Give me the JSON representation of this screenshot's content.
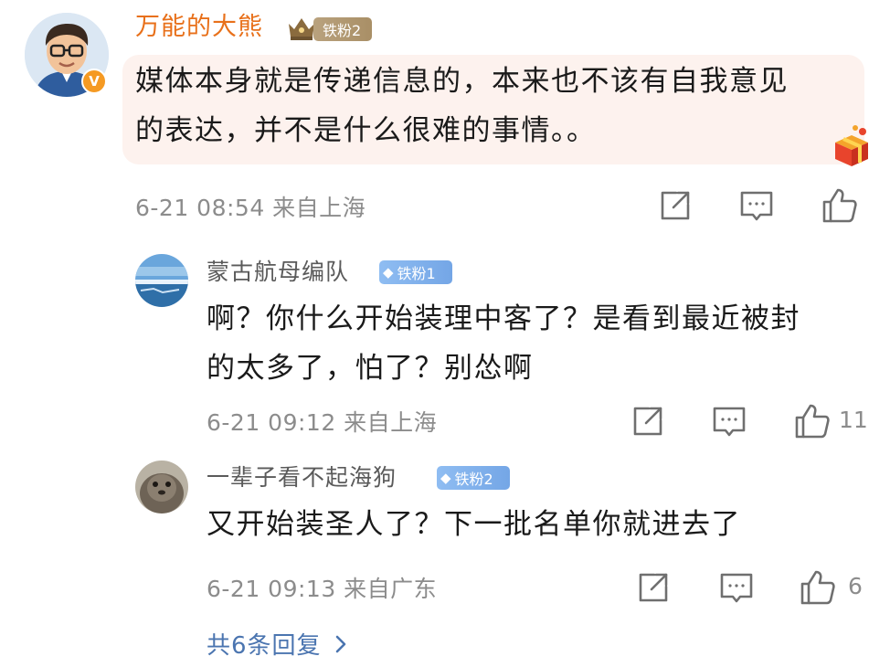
{
  "comment": {
    "username": "万能的大熊",
    "fan_badge": "铁粉2",
    "text_line1": "媒体本身就是传递信息的，本来也不该有自我意见",
    "text_line2": "的表达，并不是什么很难的事情。。",
    "meta": "6-21 08:54 来自上海",
    "avatar_icon": "cartoon-man-glasses-avatar",
    "verified_badge": "V"
  },
  "replies": [
    {
      "username": "蒙古航母编队",
      "fan_badge": "铁粉1",
      "text_line1": "啊？你什么开始装理中客了？是看到最近被封",
      "text_line2": "的太多了，怕了？别怂啊",
      "meta": "6-21 09:12 来自上海",
      "likes": "11",
      "avatar_icon": "sea-landscape-avatar"
    },
    {
      "username": "一辈子看不起海狗",
      "fan_badge": "铁粉2",
      "text_line1": "又开始装圣人了？下一批名单你就进去了",
      "meta": "6-21 09:13 来自广东",
      "likes": "6",
      "avatar_icon": "seal-avatar"
    }
  ],
  "more_replies": "共6条回复",
  "colors": {
    "username_main": "#e8701a",
    "bubble_bg": "#fdf2ee",
    "link": "#4b75b0",
    "meta": "#8c8c8c"
  }
}
